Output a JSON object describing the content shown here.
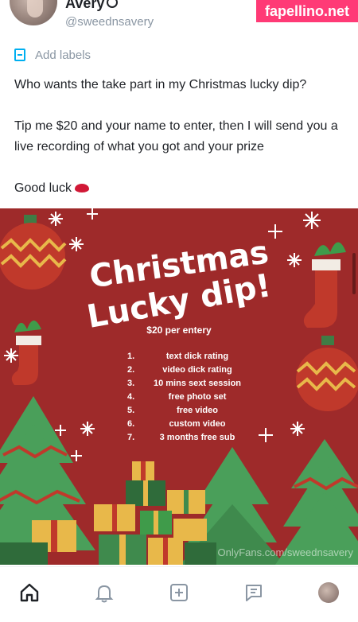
{
  "watermark": "fapellino.net",
  "profile": {
    "display_name": "Avery",
    "handle": "@sweednsavery"
  },
  "labels": {
    "add_label": "Add labels"
  },
  "post": {
    "line1": "Who wants the take part in my Christmas lucky dip?",
    "line2": "Tip me $20 and your name to enter, then I will send you a live recording of what you got and your prize",
    "line3": "Good luck"
  },
  "image": {
    "title_line1": "Christmas",
    "title_line2": "Lucky dip!",
    "price": "$20 per entery",
    "prizes": [
      {
        "num": "1.",
        "text": "text dick rating"
      },
      {
        "num": "2.",
        "text": "video dick rating"
      },
      {
        "num": "3.",
        "text": "10 mins sext session"
      },
      {
        "num": "4.",
        "text": "free photo set"
      },
      {
        "num": "5.",
        "text": "free video"
      },
      {
        "num": "6.",
        "text": "custom video"
      },
      {
        "num": "7.",
        "text": "3 months free sub"
      }
    ],
    "watermark": "OnlyFans.com/sweednsavery",
    "colors": {
      "background": "#9e2a2a",
      "tree": "#4a9f5a",
      "ornament": "#c0392b"
    }
  },
  "nav": {
    "items": [
      "home-icon",
      "notifications-icon",
      "add-post-icon",
      "messages-icon",
      "profile-avatar"
    ]
  }
}
